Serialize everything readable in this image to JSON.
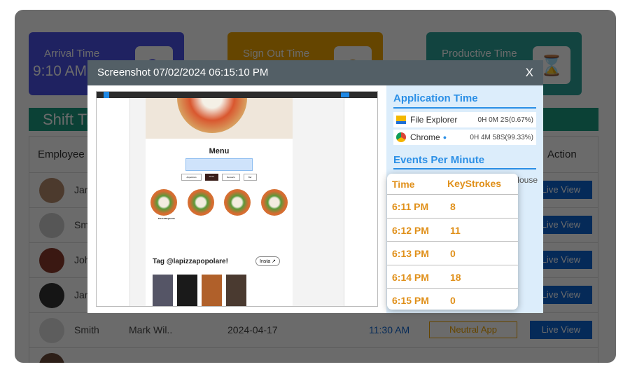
{
  "cards": [
    {
      "label": "Arrival Time",
      "value": "9:10 AM",
      "icon": "clock-refresh-icon",
      "color": "#4a52e8"
    },
    {
      "label": "Sign Out  Time",
      "value": "",
      "icon": "clock-history-icon",
      "color": "#f0a500"
    },
    {
      "label": "Productive Time",
      "value": "",
      "icon": "hourglass-icon",
      "color": "#2aa198"
    }
  ],
  "shift_title": "Shift Timings",
  "table": {
    "headers": [
      "Employee",
      "Action"
    ],
    "mouse_header": "Mouse",
    "rows": [
      {
        "name": "James"
      },
      {
        "name": "Smith"
      },
      {
        "name": "John"
      },
      {
        "name": "Jane"
      },
      {
        "name": "Smith",
        "manager": "Mark Wil..",
        "date": "2024-04-17",
        "time": "11:30 AM",
        "badge": "Neutral App"
      }
    ],
    "live_view": "Live View"
  },
  "modal": {
    "title": "Screenshot 07/02/2024 06:15:10 PM",
    "close": "X",
    "shot": {
      "menu": "Menu",
      "tabs": [
        "Appetizers",
        "Pizza",
        "Desserts",
        "Bar"
      ],
      "tag": "Tag @lapizzapopolare!",
      "insta": "Insta ↗",
      "item": "Pizza Margherita"
    },
    "app_time_title": "Application Time",
    "apps": [
      {
        "name": "File Explorer",
        "time": "0H 0M 2S(0.67%)",
        "icon": "folder-icon"
      },
      {
        "name": "Chrome",
        "time": "0H 4M 58S(99.33%)",
        "icon": "chrome-icon"
      }
    ],
    "events_title": "Events Per Minute",
    "events_headers": [
      "Time",
      "KeyStrokes"
    ],
    "events": [
      {
        "time": "6:11 PM",
        "keys": "8"
      },
      {
        "time": "6:12 PM",
        "keys": "11"
      },
      {
        "time": "6:13 PM",
        "keys": "0"
      },
      {
        "time": "6:14 PM",
        "keys": "18"
      },
      {
        "time": "6:15 PM",
        "keys": "0"
      }
    ]
  }
}
